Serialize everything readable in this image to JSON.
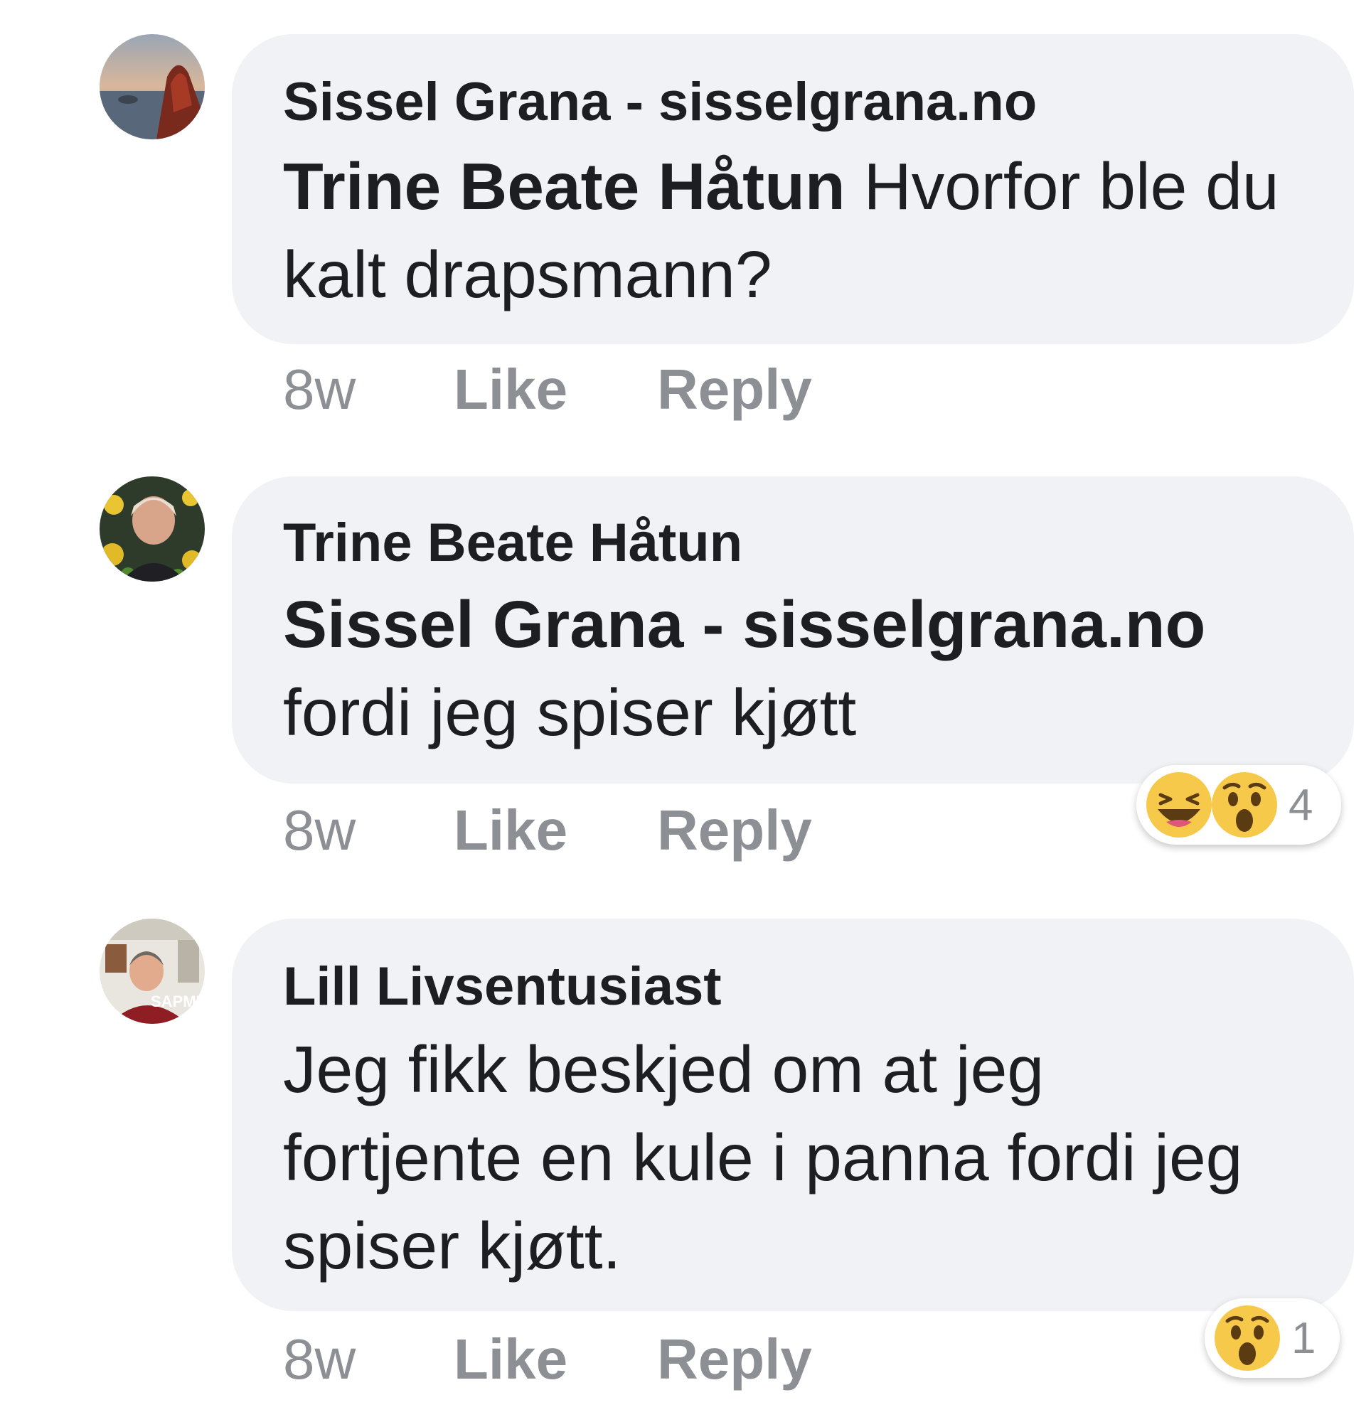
{
  "comments": [
    {
      "author": "Sissel Grana  -  sisselgrana.no",
      "mention": "Trine Beate Håtun",
      "lines": [
        "Hvorfor ble du",
        "kalt drapsmann?"
      ],
      "time": "8w",
      "like_label": "Like",
      "reply_label": "Reply"
    },
    {
      "author": "Trine Beate Håtun",
      "mention": "Sissel Grana  -  sisselgrana.no",
      "lines": [
        "fordi jeg spiser kjøtt"
      ],
      "time": "8w",
      "like_label": "Like",
      "reply_label": "Reply",
      "reactions": {
        "types": [
          "haha-icon",
          "wow-icon"
        ],
        "count": "4"
      }
    },
    {
      "author": "Lill Livsentusiast",
      "lines": [
        "Jeg fikk beskjed om at jeg",
        "fortjente en kule i panna fordi jeg",
        "spiser kjøtt."
      ],
      "time": "8w",
      "like_label": "Like",
      "reply_label": "Reply",
      "avatar_badge": "SAPMI",
      "reactions": {
        "types": [
          "wow-icon"
        ],
        "count": "1"
      }
    }
  ],
  "colors": {
    "bubble": "#f0f2f5",
    "meta": "#8c8f94",
    "text": "#1c1e21",
    "reaction_yellow": "#f7c94b"
  }
}
